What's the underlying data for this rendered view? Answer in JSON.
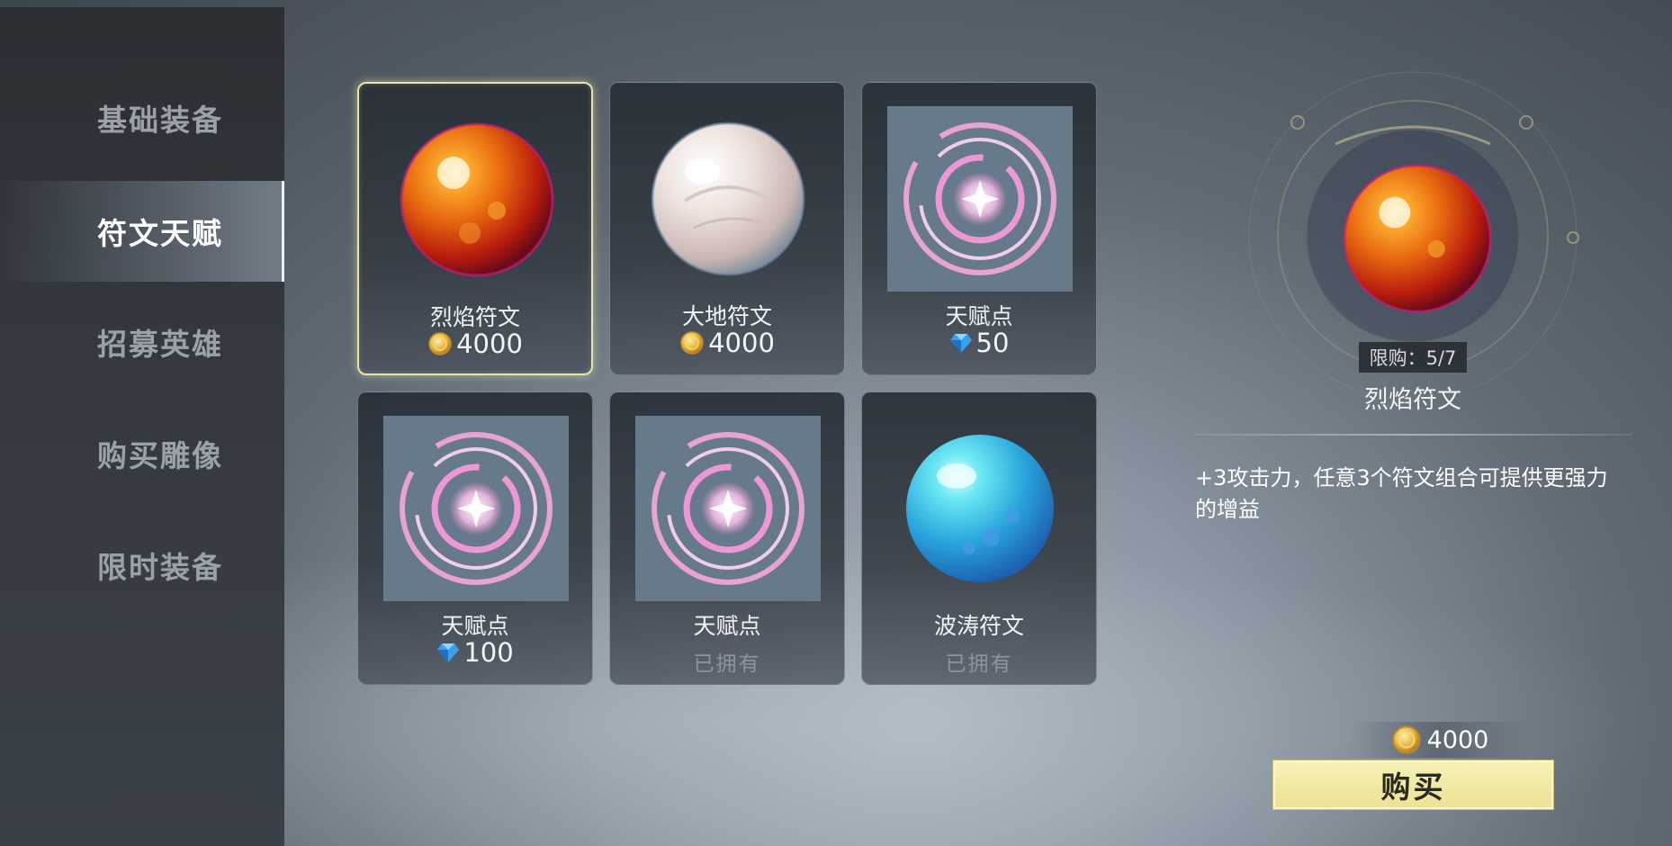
{
  "sidebar": {
    "items": [
      {
        "label": "基础装备"
      },
      {
        "label": "符文天赋"
      },
      {
        "label": "招募英雄"
      },
      {
        "label": "购买雕像"
      },
      {
        "label": "限时装备"
      }
    ],
    "active_index": 1
  },
  "shop": {
    "items": [
      {
        "name": "烈焰符文",
        "currency_icon": "gold-coin-icon",
        "price": "4000",
        "art": "fire-rune-orb",
        "selected": true
      },
      {
        "name": "大地符文",
        "currency_icon": "gold-coin-icon",
        "price": "4000",
        "art": "earth-rune-orb"
      },
      {
        "name": "天赋点",
        "currency_icon": "blue-gem-icon",
        "price": "50",
        "art": "talent-swirl"
      },
      {
        "name": "天赋点",
        "currency_icon": "blue-gem-icon",
        "price": "100",
        "art": "talent-swirl"
      },
      {
        "name": "天赋点",
        "status": "已拥有",
        "art": "talent-swirl"
      },
      {
        "name": "波涛符文",
        "status": "已拥有",
        "art": "wave-rune-orb"
      }
    ]
  },
  "detail": {
    "limit_text": "限购：5/7",
    "name": "烈焰符文",
    "description": "+3攻击力，任意3个符文组合可提供更强力的增益",
    "cost": "4000",
    "buy_label": "购买"
  },
  "colors": {
    "selected_border": "#e9e3a8",
    "buy_button": "#f2ec9f",
    "coin": "#e3b23c",
    "gem": "#3aa0e8",
    "talent_tile": "#667a8c"
  }
}
